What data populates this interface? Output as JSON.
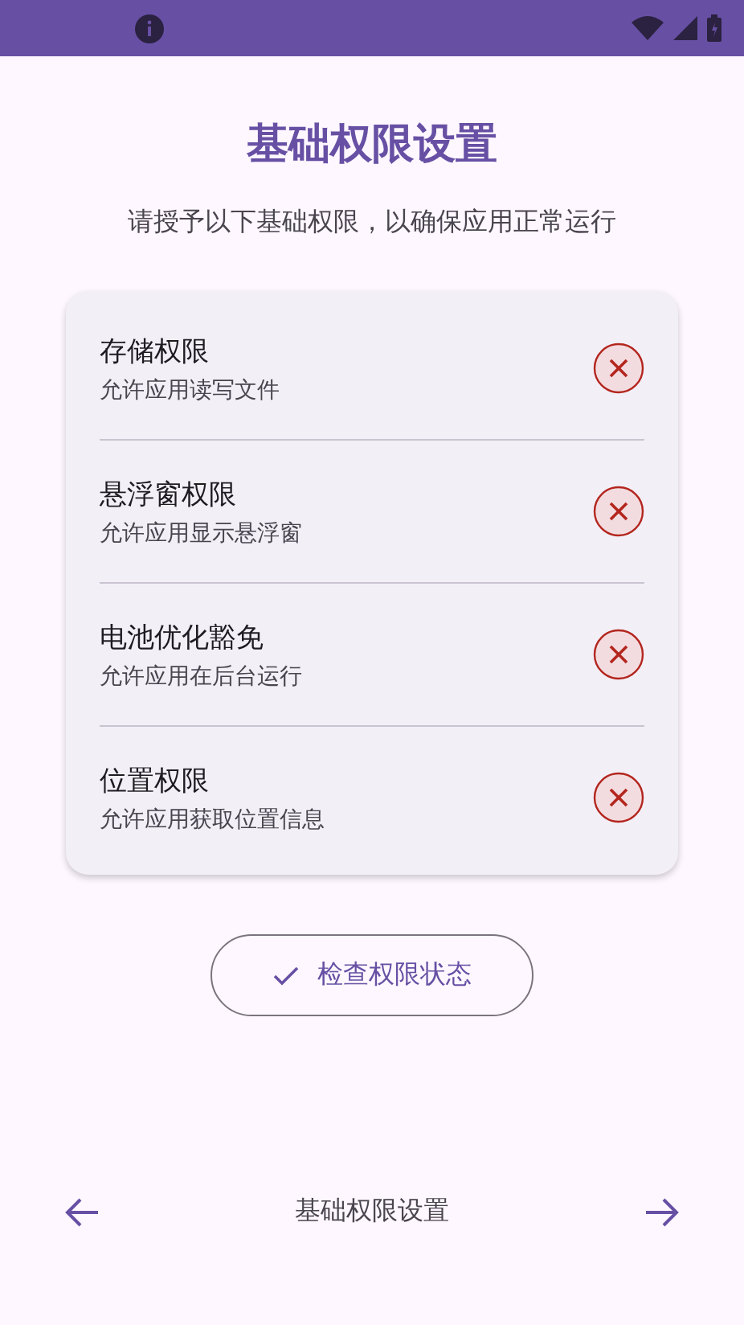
{
  "title": "基础权限设置",
  "subtitle": "请授予以下基础权限，以确保应用正常运行",
  "permissions": [
    {
      "name": "存储权限",
      "description": "允许应用读写文件",
      "granted": false
    },
    {
      "name": "悬浮窗权限",
      "description": "允许应用显示悬浮窗",
      "granted": false
    },
    {
      "name": "电池优化豁免",
      "description": "允许应用在后台运行",
      "granted": false
    },
    {
      "name": "位置权限",
      "description": "允许应用获取位置信息",
      "granted": false
    }
  ],
  "check_button": "检查权限状态",
  "bottom_nav": {
    "label": "基础权限设置"
  }
}
